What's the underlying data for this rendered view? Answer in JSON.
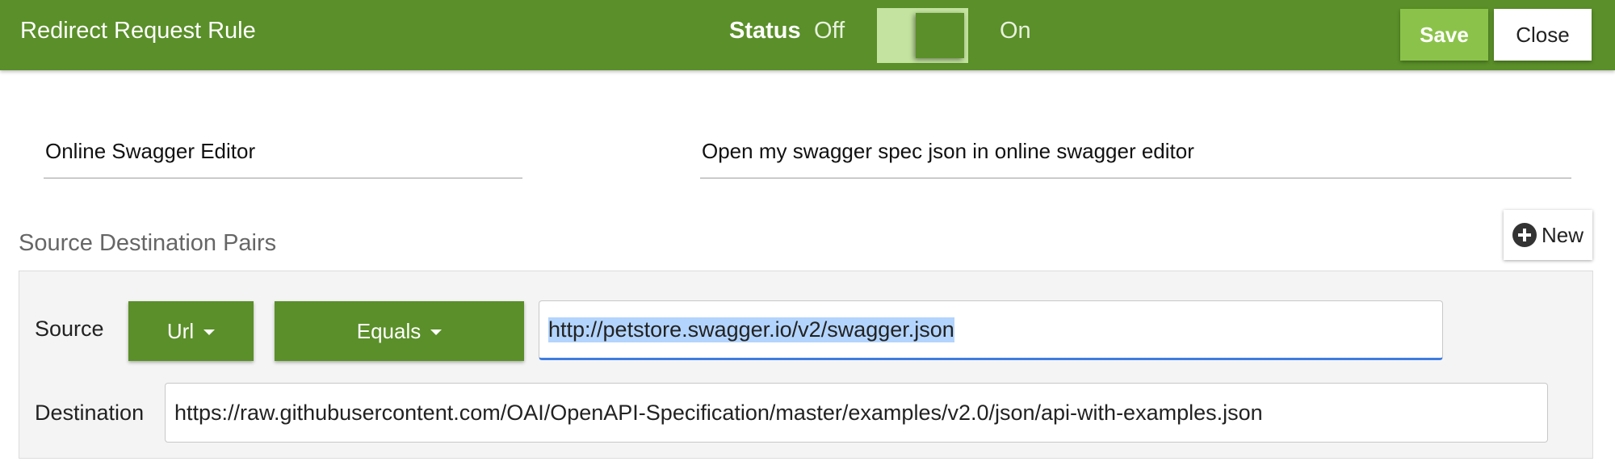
{
  "header": {
    "title": "Redirect Request Rule",
    "status_label": "Status",
    "status_off": "Off",
    "status_on": "On",
    "save_label": "Save",
    "close_label": "Close"
  },
  "rule": {
    "name": "Online Swagger Editor",
    "description": "Open my swagger spec json in online swagger editor"
  },
  "pairs": {
    "section_title": "Source Destination Pairs",
    "new_label": "New",
    "source_label": "Source",
    "source_key": "Url",
    "source_operator": "Equals",
    "source_value": "http://petstore.swagger.io/v2/swagger.json",
    "destination_label": "Destination",
    "destination_value": "https://raw.githubusercontent.com/OAI/OpenAPI-Specification/master/examples/v2.0/json/api-with-examples.json"
  },
  "icons": {
    "new": "plus-circle-icon",
    "dropdown": "caret-down-icon"
  },
  "colors": {
    "header_bg": "#5a8f29",
    "save_bg": "#8bc34a",
    "toggle_track": "#c4e3a0",
    "focus_underline": "#3f7de0",
    "selection": "#b3d4fc"
  }
}
